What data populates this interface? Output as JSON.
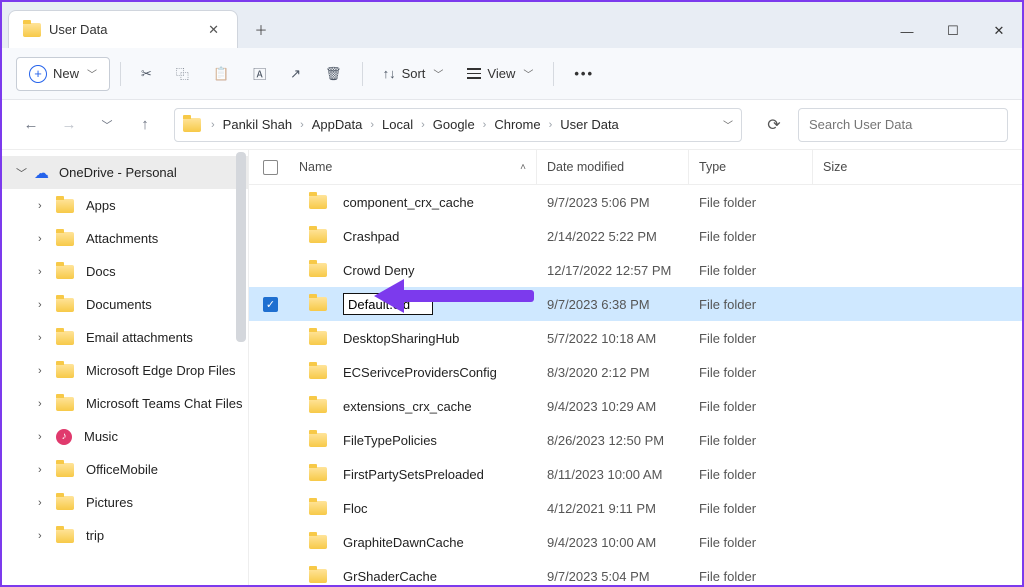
{
  "tab": {
    "title": "User Data"
  },
  "toolbar": {
    "new": "New",
    "sort": "Sort",
    "view": "View"
  },
  "breadcrumbs": [
    "Pankil Shah",
    "AppData",
    "Local",
    "Google",
    "Chrome",
    "User Data"
  ],
  "search": {
    "placeholder": "Search User Data"
  },
  "sidebar": {
    "root": "OneDrive - Personal",
    "items": [
      "Apps",
      "Attachments",
      "Docs",
      "Documents",
      "Email attachments",
      "Microsoft Edge Drop Files",
      "Microsoft Teams Chat Files",
      "Music",
      "OfficeMobile",
      "Pictures",
      "trip"
    ]
  },
  "columns": {
    "name": "Name",
    "date": "Date modified",
    "type": "Type",
    "size": "Size"
  },
  "rename_value": "Default.old",
  "rows": [
    {
      "name": "component_crx_cache",
      "date": "9/7/2023 5:06 PM",
      "type": "File folder"
    },
    {
      "name": "Crashpad",
      "date": "2/14/2022 5:22 PM",
      "type": "File folder"
    },
    {
      "name": "Crowd Deny",
      "date": "12/17/2022 12:57 PM",
      "type": "File folder"
    },
    {
      "name": "Default.old",
      "date": "9/7/2023 6:38 PM",
      "type": "File folder",
      "selected": true,
      "renaming": true
    },
    {
      "name": "DesktopSharingHub",
      "date": "5/7/2022 10:18 AM",
      "type": "File folder"
    },
    {
      "name": "ECSerivceProvidersConfig",
      "date": "8/3/2020 2:12 PM",
      "type": "File folder"
    },
    {
      "name": "extensions_crx_cache",
      "date": "9/4/2023 10:29 AM",
      "type": "File folder"
    },
    {
      "name": "FileTypePolicies",
      "date": "8/26/2023 12:50 PM",
      "type": "File folder"
    },
    {
      "name": "FirstPartySetsPreloaded",
      "date": "8/11/2023 10:00 AM",
      "type": "File folder"
    },
    {
      "name": "Floc",
      "date": "4/12/2021 9:11 PM",
      "type": "File folder"
    },
    {
      "name": "GraphiteDawnCache",
      "date": "9/4/2023 10:00 AM",
      "type": "File folder"
    },
    {
      "name": "GrShaderCache",
      "date": "9/7/2023 5:04 PM",
      "type": "File folder"
    }
  ]
}
